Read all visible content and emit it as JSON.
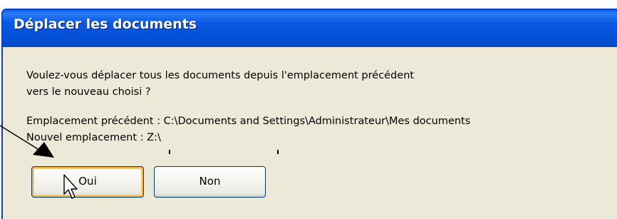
{
  "dialog": {
    "title": "Déplacer les documents",
    "message_line1": "Voulez-vous déplacer tous les documents depuis l'emplacement précédent",
    "message_line2": "vers le nouveau choisi ?",
    "previous_location": "Emplacement précédent : C:\\Documents and Settings\\Administrateur\\Mes documents",
    "new_location": "Nouvel emplacement : Z:\\"
  },
  "buttons": {
    "yes_label": "Oui",
    "no_label": "Non"
  },
  "icons": {
    "cursor": "mouse-pointer-icon",
    "annotation": "arrow-annotation-icon"
  },
  "colors": {
    "titlebar": "#0450d8",
    "dialog_bg": "#ece9d8",
    "focus_ring": "#f8b33d"
  }
}
